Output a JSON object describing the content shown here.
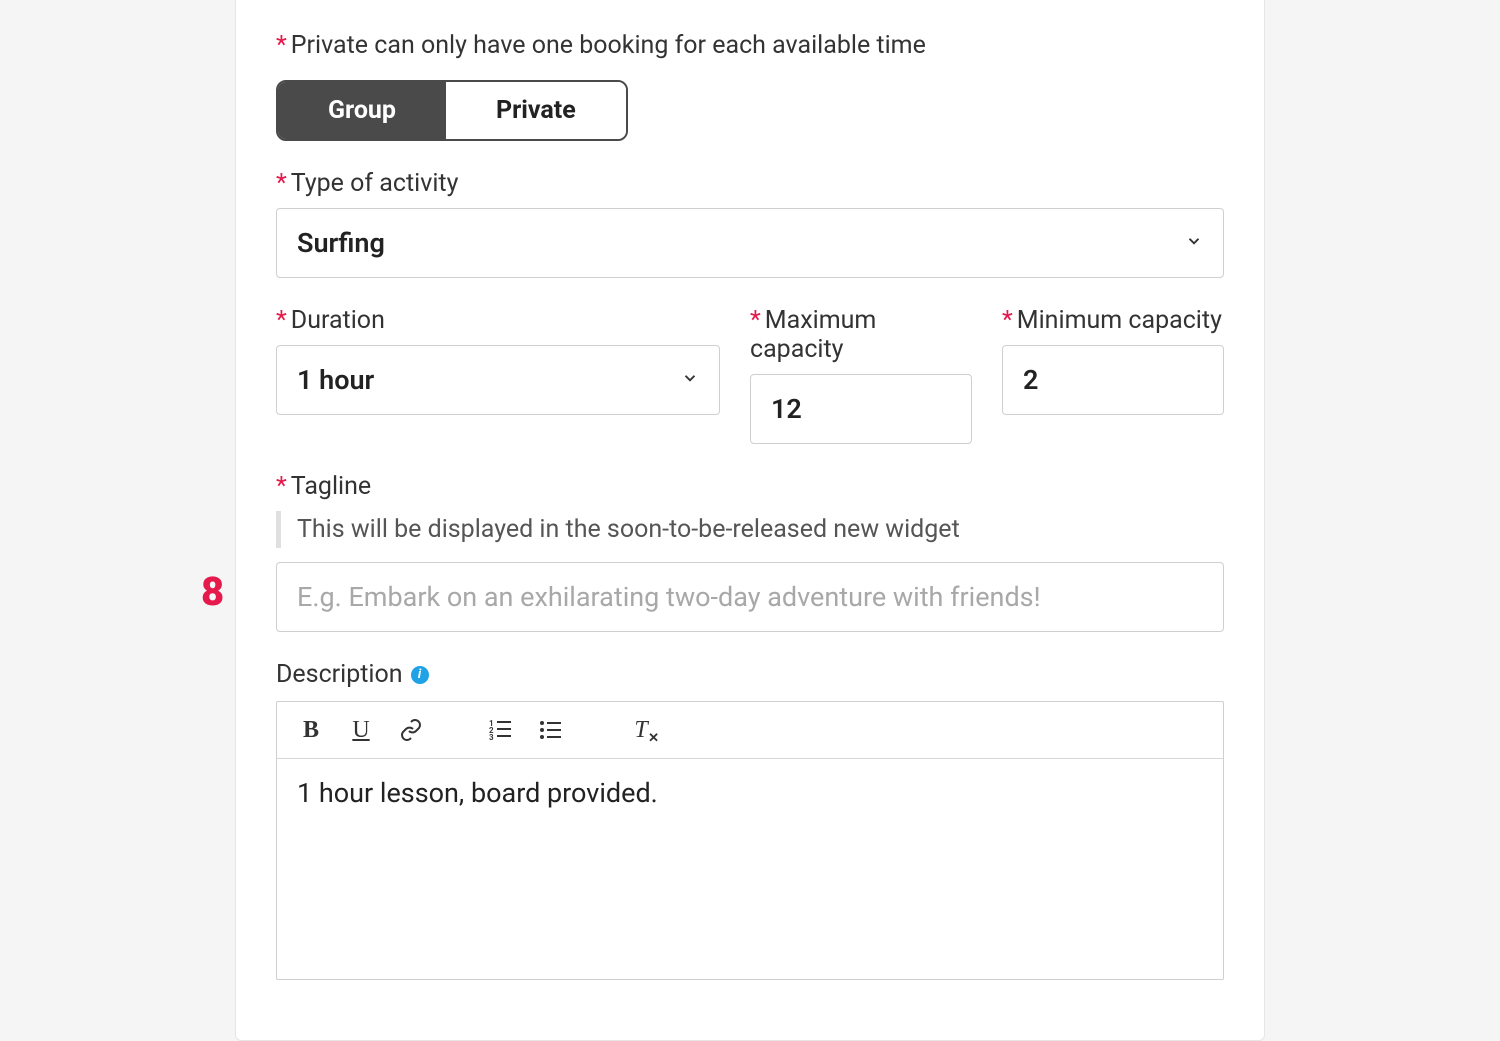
{
  "booking_note": "Private can only have one booking for each available time",
  "toggle": {
    "group": "Group",
    "private": "Private",
    "active": "group"
  },
  "labels": {
    "type_of_activity": "Type of activity",
    "duration": "Duration",
    "max_capacity": "Maximum capacity",
    "min_capacity": "Minimum capacity",
    "tagline": "Tagline",
    "description": "Description"
  },
  "values": {
    "activity_type": "Surfing",
    "duration": "1 hour",
    "max_capacity": "12",
    "min_capacity": "2",
    "tagline": "",
    "description_text": "1 hour lesson, board provided."
  },
  "tagline_hint": "This will be displayed in the soon-to-be-released new widget",
  "tagline_placeholder": "E.g. Embark on an exhilarating two-day adventure with friends!",
  "step_number": "8"
}
